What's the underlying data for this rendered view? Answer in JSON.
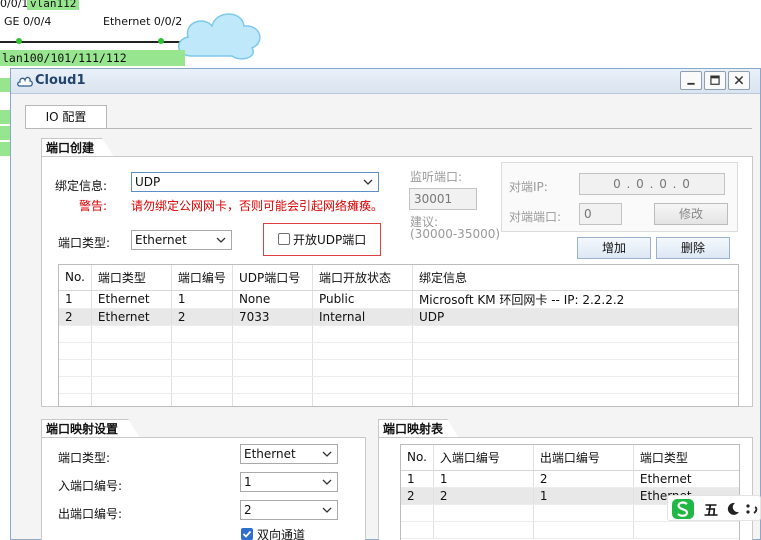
{
  "topology": {
    "port_label_1": "0/0/1",
    "vlan_label": "vlan112",
    "ge_label": "GE 0/0/4",
    "eth_label": "Ethernet 0/0/2",
    "vlan_list": "lan100/101/111/112"
  },
  "window": {
    "title": "Cloud1"
  },
  "tabs": [
    {
      "label": "IO 配置"
    }
  ],
  "port_create": {
    "group_title": "端口创建",
    "bind_label": "绑定信息:",
    "bind_value": "UDP",
    "warning_label": "警告:",
    "warning_text": "请勿绑定公网网卡，否则可能会引起网络瘫痪。",
    "port_type_label": "端口类型:",
    "port_type_value": "Ethernet",
    "open_udp_label": "开放UDP端口",
    "listen_port_label": "监听端口:",
    "listen_port_value": "30001",
    "suggest_label": "建议:",
    "suggest_range": "(30000-35000)",
    "peer_ip_label": "对端IP:",
    "peer_ip_value": "0 . 0 . 0 . 0",
    "peer_port_label": "对端端口:",
    "peer_port_value": "0",
    "modify_button": "修改",
    "add_button": "增加",
    "delete_button": "删除",
    "table": {
      "headers": [
        "No.",
        "端口类型",
        "端口编号",
        "UDP端口号",
        "端口开放状态",
        "绑定信息"
      ],
      "rows": [
        [
          "1",
          "Ethernet",
          "1",
          "None",
          "Public",
          "Microsoft KM 环回网卡 -- IP: 2.2.2.2"
        ],
        [
          "2",
          "Ethernet",
          "2",
          "7033",
          "Internal",
          "UDP"
        ]
      ]
    }
  },
  "port_mapping": {
    "group_title": "端口映射设置",
    "type_label": "端口类型:",
    "type_value": "Ethernet",
    "in_label": "入端口编号:",
    "in_value": "1",
    "out_label": "出端口编号:",
    "out_value": "2",
    "bidirectional_label": "双向通道"
  },
  "mapping_table": {
    "group_title": "端口映射表",
    "headers": [
      "No.",
      "入端口编号",
      "出端口编号",
      "端口类型"
    ],
    "rows": [
      [
        "1",
        "1",
        "2",
        "Ethernet"
      ],
      [
        "2",
        "2",
        "1",
        "Ethernet"
      ]
    ]
  },
  "ime": {
    "label": "五"
  },
  "colors": {
    "accent": "#2f6fd0",
    "warning": "#dd0000",
    "highlight": "#97e58e"
  }
}
